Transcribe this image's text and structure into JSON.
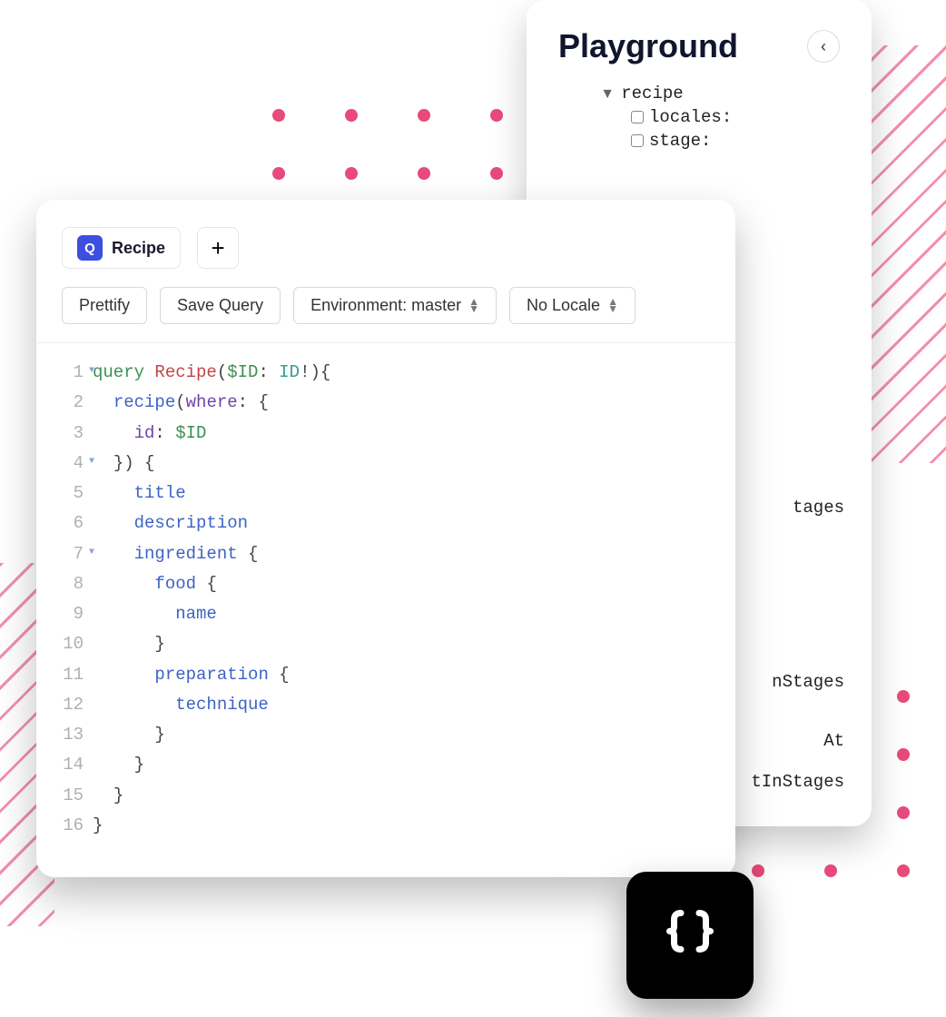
{
  "playground": {
    "title": "Playground",
    "tree": {
      "root": "recipe",
      "children": [
        {
          "label": "locales:"
        },
        {
          "label": "stage:"
        }
      ]
    },
    "peek_fragments": [
      "tages",
      "nStages",
      "At",
      "tInStages"
    ]
  },
  "editor": {
    "tab_badge": "Q",
    "tab_label": "Recipe",
    "toolbar": {
      "prettify": "Prettify",
      "save_query": "Save Query",
      "environment": "Environment: master",
      "locale": "No Locale"
    },
    "code": [
      {
        "n": 1,
        "fold": true,
        "html": "<span class='tok-kw'>query</span> <span class='tok-def'>Recipe</span><span class='tok-punc'>(</span><span class='tok-var'>$ID</span><span class='tok-punc'>:</span> <span class='tok-type'>ID</span><span class='tok-punc'>!){</span>"
      },
      {
        "n": 2,
        "fold": false,
        "html": "  <span class='tok-attr'>recipe</span><span class='tok-punc'>(</span><span class='tok-arg'>where</span><span class='tok-punc'>: {</span>"
      },
      {
        "n": 3,
        "fold": false,
        "html": "    <span class='tok-arg'>id</span><span class='tok-punc'>:</span> <span class='tok-var'>$ID</span>"
      },
      {
        "n": 4,
        "fold": true,
        "html": "  <span class='tok-punc'>}) {</span>"
      },
      {
        "n": 5,
        "fold": false,
        "html": "    <span class='tok-attr'>title</span>"
      },
      {
        "n": 6,
        "fold": false,
        "html": "    <span class='tok-attr'>description</span>"
      },
      {
        "n": 7,
        "fold": true,
        "html": "    <span class='tok-attr'>ingredient</span> <span class='tok-punc'>{</span>"
      },
      {
        "n": 8,
        "fold": false,
        "html": "      <span class='tok-attr'>food</span> <span class='tok-punc'>{</span>"
      },
      {
        "n": 9,
        "fold": false,
        "html": "        <span class='tok-attr'>name</span>"
      },
      {
        "n": 10,
        "fold": false,
        "html": "      <span class='tok-punc'>}</span>"
      },
      {
        "n": 11,
        "fold": false,
        "html": "      <span class='tok-attr'>preparation</span> <span class='tok-punc'>{</span>"
      },
      {
        "n": 12,
        "fold": false,
        "html": "        <span class='tok-attr'>technique</span>"
      },
      {
        "n": 13,
        "fold": false,
        "html": "      <span class='tok-punc'>}</span>"
      },
      {
        "n": 14,
        "fold": false,
        "html": "    <span class='tok-punc'>}</span>"
      },
      {
        "n": 15,
        "fold": false,
        "html": "  <span class='tok-punc'>}</span>"
      },
      {
        "n": 16,
        "fold": false,
        "html": "<span class='tok-punc'>}</span>"
      }
    ]
  }
}
